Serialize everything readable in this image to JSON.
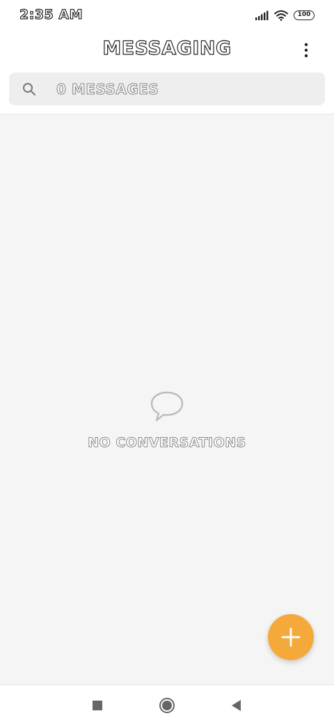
{
  "status_bar": {
    "time": "2:35 AM",
    "battery": "100",
    "icons": [
      "signal-icon",
      "wifi-icon",
      "battery-icon"
    ]
  },
  "header": {
    "title": "MESSAGING",
    "menu_icon": "more-vert-icon"
  },
  "search": {
    "placeholder": "0 MESSAGES",
    "icon": "search-icon"
  },
  "empty_state": {
    "icon": "chat-bubble-icon",
    "text": "NO CONVERSATIONS"
  },
  "fab": {
    "icon": "plus-icon",
    "color": "#f5a93a"
  },
  "navigation_bar": {
    "buttons": [
      "recents-square-icon",
      "home-circle-icon",
      "back-triangle-icon"
    ]
  }
}
